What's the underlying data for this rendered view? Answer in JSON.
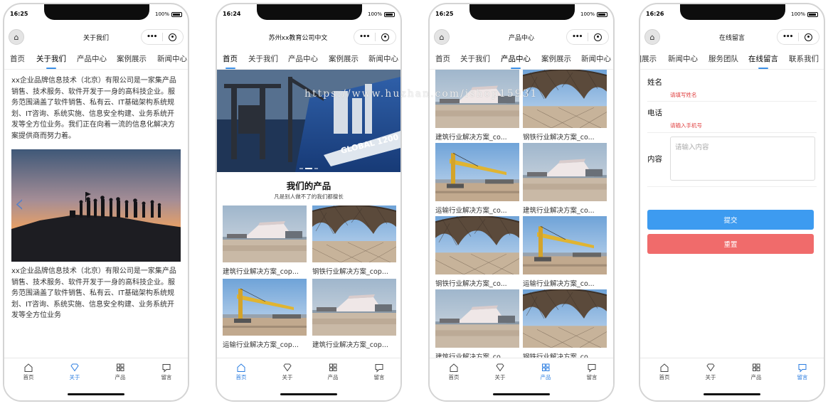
{
  "statusbar": {
    "screen1_time": "16:25",
    "screen2_time": "16:24",
    "screen3_time": "16:25",
    "screen4_time": "16:26",
    "battery": "100%"
  },
  "capsule": {
    "more": "•••"
  },
  "tabs": [
    "首页",
    "关于我们",
    "产品中心",
    "案例展示",
    "新闻中心",
    "服务团队",
    "在线留言",
    "联系我们"
  ],
  "screen1": {
    "title": "关于我们",
    "active_tab": "关于我们",
    "text_top": "xx企业品牌信息技术（北京）有限公司是一家集产品销售、技术服务、软件开发于一身的高科技企业。服务范围涵盖了软件销售、私有云、IT基础架构系统规划、IT咨询、系统实施、信息安全构建、业务系统开发等全方位业务。我们正在向着一流的信息化解决方案提供商而努力着。",
    "text_bottom": "xx企业品牌信息技术（北京）有限公司是一家集产品销售、技术服务、软件开发于一身的高科技企业。服务范围涵盖了软件销售、私有云、IT基础架构系统规划、IT咨询、系统实施、信息安全构建、业务系统开发等全方位业务"
  },
  "screen2": {
    "title": "苏州xx教育公司中文",
    "active_tab": "首页",
    "banner_ship_text": "GLOBAL 1200",
    "section_title": "我们的产品",
    "section_subtitle": "凡是别人做不了的我们都擅长",
    "products": [
      {
        "caption": "建筑行业解决方案_cop...",
        "image": "port"
      },
      {
        "caption": "钢铁行业解决方案_cop...",
        "image": "arch"
      },
      {
        "caption": "运输行业解决方案_cop...",
        "image": "crane"
      },
      {
        "caption": "建筑行业解决方案_cop...",
        "image": "port"
      }
    ]
  },
  "screen3": {
    "title": "产品中心",
    "active_tab": "产品中心",
    "products": [
      {
        "caption": "建筑行业解决方案_co...",
        "image": "port"
      },
      {
        "caption": "钢铁行业解决方案_co...",
        "image": "arch"
      },
      {
        "caption": "运输行业解决方案_co...",
        "image": "crane"
      },
      {
        "caption": "建筑行业解决方案_co...",
        "image": "port"
      },
      {
        "caption": "钢铁行业解决方案_co...",
        "image": "arch"
      },
      {
        "caption": "运输行业解决方案_co...",
        "image": "crane"
      },
      {
        "caption": "建筑行业解决方案_co...",
        "image": "port"
      },
      {
        "caption": "钢铁行业解决方案_co...",
        "image": "arch"
      }
    ]
  },
  "screen4": {
    "title": "在线留言",
    "active_tab": "在线留言",
    "visible_tabs": [
      "]展示",
      "新闻中心",
      "服务团队",
      "在线留言",
      "联系我们"
    ],
    "name_label": "姓名",
    "name_hint": "请填写姓名",
    "phone_label": "电话",
    "phone_hint": "请输入手机号",
    "content_label": "内容",
    "content_placeholder": "请输入内容",
    "submit": "提交",
    "reset": "重置"
  },
  "bottom_tabs": [
    "首页",
    "关于",
    "产品",
    "留言"
  ],
  "watermark": "https://www.huzhan.com/ishop15931",
  "colors": {
    "accent": "#3a8ee6",
    "submit": "#3d9bf0",
    "reset": "#f06b6b",
    "hint": "#e04040"
  }
}
